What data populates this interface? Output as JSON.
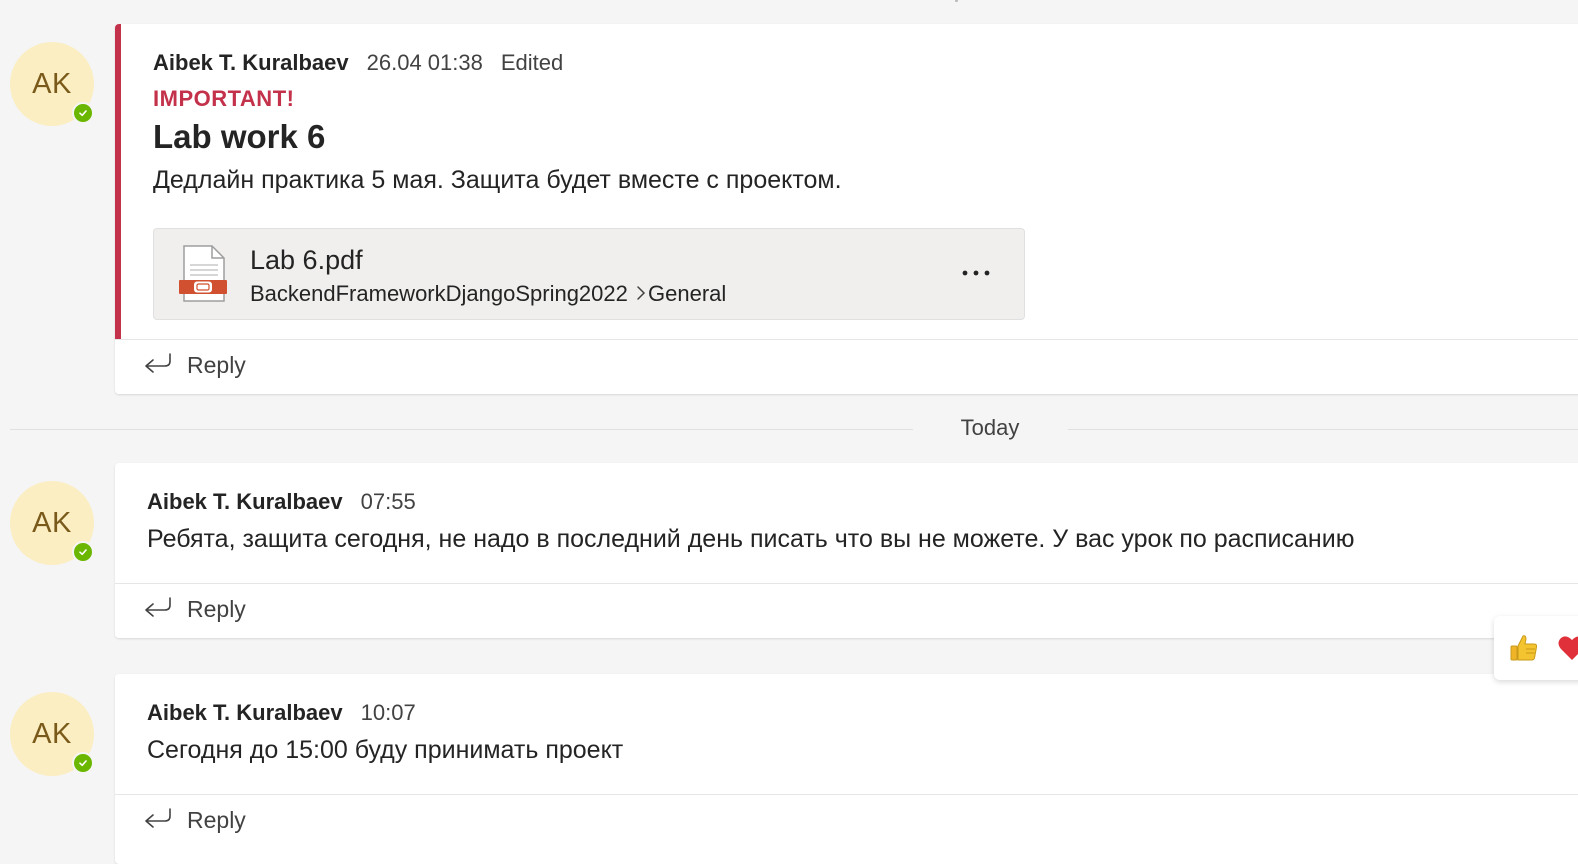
{
  "messages": [
    {
      "avatar_initials": "AK",
      "author": "Aibek T. Kuralbaev",
      "timestamp": "26.04 01:38",
      "edited": "Edited",
      "importance": "IMPORTANT!",
      "subject": "Lab work 6",
      "text": "Дедлайн практика 5 мая. Защита будет вместе с проектом.",
      "attachment": {
        "file_name": "Lab 6.pdf",
        "path_team": "BackendFrameworkDjangoSpring2022",
        "path_channel": "General",
        "more": "..."
      },
      "reply_label": "Reply"
    },
    {
      "avatar_initials": "AK",
      "author": "Aibek T. Kuralbaev",
      "timestamp": "07:55",
      "text": "Ребята, защита сегодня, не надо в последний день писать что вы не можете. У вас урок по расписанию",
      "reply_label": "Reply"
    },
    {
      "avatar_initials": "AK",
      "author": "Aibek T. Kuralbaev",
      "timestamp": "10:07",
      "text": "Сегодня до 15:00 буду принимать проект",
      "reply_label": "Reply"
    }
  ],
  "date_separator": "Today",
  "reactions": [
    {
      "icon": "thumbs-up-icon"
    },
    {
      "icon": "heart-icon"
    }
  ],
  "colors": {
    "important": "#c4314b",
    "avatar_bg": "#fbeec2",
    "presence_available": "#6bb700",
    "pdf_red": "#d0502f"
  }
}
